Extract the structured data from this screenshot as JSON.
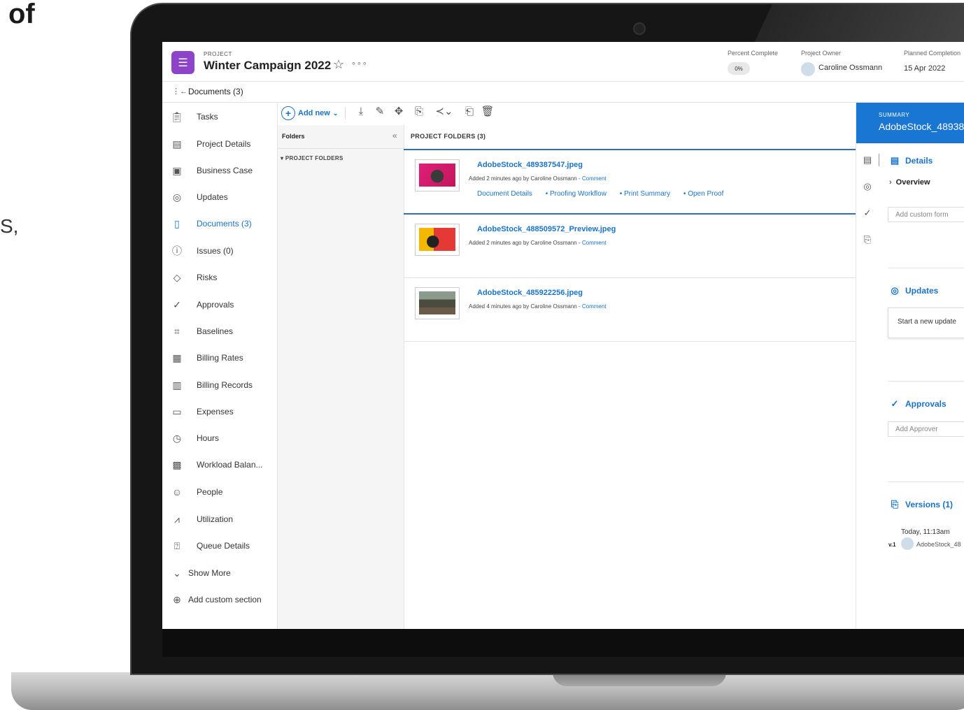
{
  "background": {
    "heading_fragment": "of",
    "body_fragment": "S,"
  },
  "header": {
    "project_label": "PROJECT",
    "project_title": "Winter Campaign 2022",
    "percent_complete_label": "Percent Complete",
    "percent_complete_value": "0%",
    "project_owner_label": "Project Owner",
    "project_owner_name": "Caroline Ossmann",
    "planned_completion_label": "Planned Completion",
    "planned_completion_value": "15 Apr 2022"
  },
  "subheader": {
    "title": "Documents (3)"
  },
  "sidebar": {
    "items": [
      {
        "label": "Tasks",
        "icon": "clipboard-icon"
      },
      {
        "label": "Project Details",
        "icon": "document-icon"
      },
      {
        "label": "Business Case",
        "icon": "business-case-icon"
      },
      {
        "label": "Updates",
        "icon": "chat-bubble-icon"
      },
      {
        "label": "Documents (3)",
        "icon": "file-icon"
      },
      {
        "label": "Issues (0)",
        "icon": "issue-bubble-icon"
      },
      {
        "label": "Risks",
        "icon": "risk-diamond-icon"
      },
      {
        "label": "Approvals",
        "icon": "check-circle-icon"
      },
      {
        "label": "Baselines",
        "icon": "baseline-icon"
      },
      {
        "label": "Billing Rates",
        "icon": "billing-rates-icon"
      },
      {
        "label": "Billing Records",
        "icon": "billing-records-icon"
      },
      {
        "label": "Expenses",
        "icon": "money-icon"
      },
      {
        "label": "Hours",
        "icon": "clock-icon"
      },
      {
        "label": "Workload Balan...",
        "icon": "calendar-icon"
      },
      {
        "label": "People",
        "icon": "people-icon"
      },
      {
        "label": "Utilization",
        "icon": "chart-line-icon"
      },
      {
        "label": "Queue Details",
        "icon": "queue-icon"
      }
    ],
    "show_more": "Show More",
    "add_custom_section": "Add custom section"
  },
  "toolbar": {
    "add_new_label": "Add new"
  },
  "folders": {
    "title": "Folders",
    "tree_root": "PROJECT FOLDERS"
  },
  "documents": {
    "header": "PROJECT FOLDERS (3)",
    "rows": [
      {
        "name": "AdobeStock_489387547.jpeg",
        "meta": "Added 2 minutes ago by Caroline Ossmann - ",
        "comment": "Comment",
        "links": [
          "Document Details",
          "• Proofing Workflow",
          "• Print Summary",
          "• Open Proof"
        ]
      },
      {
        "name": "AdobeStock_488509572_Preview.jpeg",
        "meta": "Added 2 minutes ago by Caroline Ossmann - ",
        "comment": "Comment"
      },
      {
        "name": "AdobeStock_485922256.jpeg",
        "meta": "Added 4 minutes ago by Caroline Ossmann - ",
        "comment": "Comment"
      }
    ]
  },
  "summary": {
    "label": "SUMMARY",
    "title": "AdobeStock_48938",
    "details_title": "Details",
    "overview": "Overview",
    "custom_form_placeholder": "Add custom form",
    "updates_title": "Updates",
    "update_prompt": "Start a new update",
    "approvals_title": "Approvals",
    "approver_placeholder": "Add Approver",
    "versions_title": "Versions (1)",
    "version_number": "v.1",
    "version_time": "Today, 11:13am",
    "version_file": "AdobeStock_48"
  },
  "colors": {
    "accent": "#1a73c8",
    "summary_header": "#1976d2",
    "project_icon": "#8e44c8"
  }
}
